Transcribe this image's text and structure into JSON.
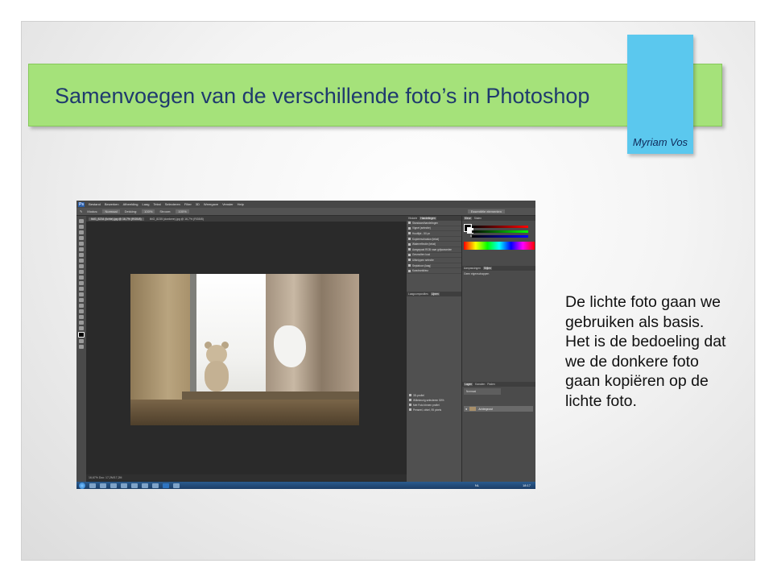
{
  "slide": {
    "title": "Samenvoegen van de verschillende foto’s in Photoshop",
    "author": "Myriam Vos",
    "body_lines": [
      "De lichte foto gaan we",
      "gebruiken als basis.",
      "Het is de bedoeling dat",
      "we de donkere foto",
      "gaan kopiëren op de",
      "lichte foto."
    ],
    "colors": {
      "title_bar": "#a5e27a",
      "accent_block": "#5bc8ee",
      "title_text": "#1f3a6e"
    }
  },
  "photoshop": {
    "logo": "Ps",
    "menu": [
      "Bestand",
      "Bewerken",
      "Afbeelding",
      "Laag",
      "Tekst",
      "Selecteren",
      "Filter",
      "3D",
      "Weergave",
      "Venster",
      "Help"
    ],
    "options": {
      "modus_label": "Modus:",
      "modus_value": "Normaal",
      "dekking_label": "Dekking:",
      "dekking_value": "100%",
      "stroom_label": "Stroom:",
      "stroom_value": "100%"
    },
    "workspace": "Essentiële elementen",
    "doc_tabs": [
      "IMG_8234 (lichte).jpg @ 16,7% (RGB/8)",
      "IMG_8235 (donkere).jpg @ 16,7% (RGB/8)"
    ],
    "status": "16,67%   Doc: 17,2M/17,2M",
    "actions_panel": {
      "tabs": [
        "Historie",
        "Handelingen"
      ],
      "items": [
        "Standaardhandelingen",
        "Vignet (selectie)",
        "Houtlijst - 50 px",
        "Kopieerschaduw (tekst)",
        "Waterreflectie (tekst)",
        "Aangepast RGB naar grijswaarden",
        "Gesmolten lood",
        "Uitknippen selectie",
        "Sepiatoon (laag)",
        "Kwadrantkleur"
      ]
    },
    "history_panel": {
      "tabs": [
        "Laagcomposities",
        "Lijnen"
      ],
      "items": [
        "3D-profiel",
        "Willekeurig selecteren 50%",
        "Met Foto binnen profiel",
        "Penseel, cirkel, 95 pixels"
      ]
    },
    "color_panel": {
      "tabs": [
        "Kleur",
        "Stalen"
      ],
      "channels": [
        "R",
        "G",
        "B"
      ]
    },
    "adjust_panel": {
      "tabs": [
        "Aanpassingen",
        "Stijlen"
      ],
      "title": "Geen eigenschappen"
    },
    "layers_panel": {
      "tabs": [
        "Lagen",
        "Kanalen",
        "Paden"
      ],
      "mode": "Normaal",
      "layer_name": "Achtergrond"
    },
    "taskbar": {
      "language": "NL",
      "clock": "18:17"
    }
  }
}
